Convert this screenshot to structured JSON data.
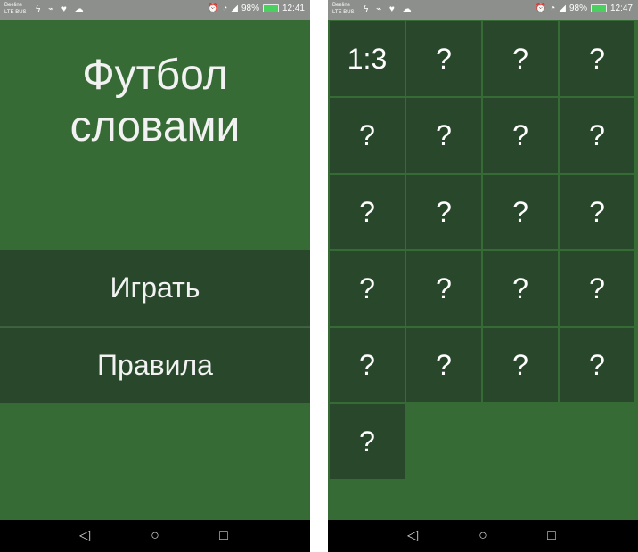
{
  "status_bar": {
    "left": [
      "Beeline",
      "LTE BUS"
    ],
    "battery": "98%",
    "time_left": "12:41",
    "time_right": "12:47"
  },
  "menu": {
    "title_line1": "Футбол",
    "title_line2": "словами",
    "play_label": "Играть",
    "rules_label": "Правила"
  },
  "level_grid": {
    "cells": [
      "1:3",
      "?",
      "?",
      "?",
      "?",
      "?",
      "?",
      "?",
      "?",
      "?",
      "?",
      "?",
      "?",
      "?",
      "?",
      "?",
      "?",
      "?",
      "?",
      "?",
      "?"
    ]
  },
  "colors": {
    "background": "#376b36",
    "tile": "#29482b",
    "status_bar": "#8c8f8c"
  }
}
